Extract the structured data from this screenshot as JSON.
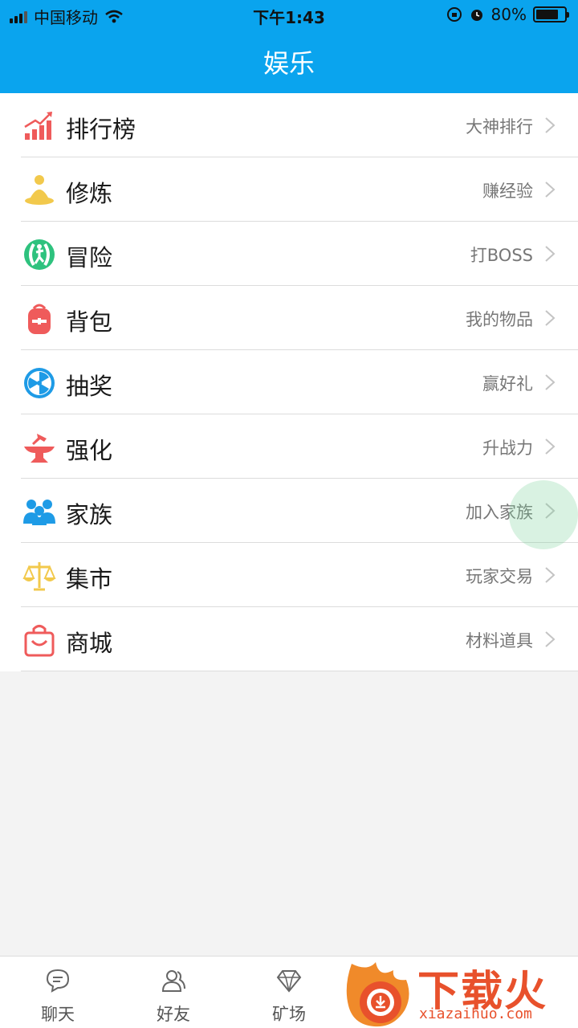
{
  "status_bar": {
    "carrier": "中国移动",
    "time": "下午1:43",
    "battery": "80%",
    "battery_level": 0.8
  },
  "nav": {
    "title": "娱乐"
  },
  "menu": {
    "items": [
      {
        "label": "排行榜",
        "sub": "大神排行",
        "icon": "leaderboard-icon",
        "color": "#ef5b5b"
      },
      {
        "label": "修炼",
        "sub": "赚经验",
        "icon": "meditation-icon",
        "color": "#f2c94c"
      },
      {
        "label": "冒险",
        "sub": "打BOSS",
        "icon": "adventure-icon",
        "color": "#2ec27e"
      },
      {
        "label": "背包",
        "sub": "我的物品",
        "icon": "backpack-icon",
        "color": "#ef5b5b"
      },
      {
        "label": "抽奖",
        "sub": "赢好礼",
        "icon": "lottery-wheel-icon",
        "color": "#1e9be6"
      },
      {
        "label": "强化",
        "sub": "升战力",
        "icon": "anvil-icon",
        "color": "#ef5b5b"
      },
      {
        "label": "家族",
        "sub": "加入家族",
        "icon": "family-icon",
        "color": "#1e9be6"
      },
      {
        "label": "集市",
        "sub": "玩家交易",
        "icon": "scale-icon",
        "color": "#f2c94c"
      },
      {
        "label": "商城",
        "sub": "材料道具",
        "icon": "shopping-bag-icon",
        "color": "#ef5b5b"
      }
    ]
  },
  "tabs": [
    {
      "label": "聊天",
      "icon": "chat-icon"
    },
    {
      "label": "好友",
      "icon": "friends-icon"
    },
    {
      "label": "矿场",
      "icon": "diamond-icon"
    }
  ],
  "watermark": {
    "text": "下载火",
    "url": "xiazaihuo.com"
  }
}
